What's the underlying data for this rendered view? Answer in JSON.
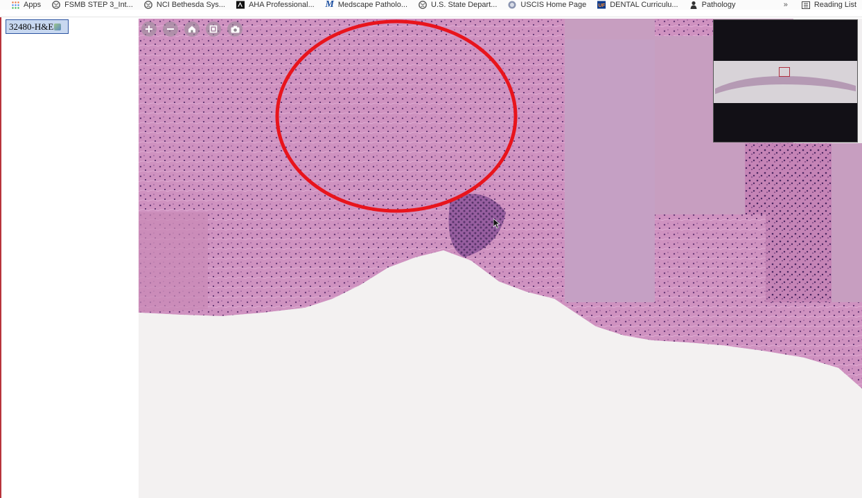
{
  "bookmarks": [
    {
      "label": "Apps",
      "icon": "apps-grid-icon"
    },
    {
      "label": "FSMB STEP 3_Int...",
      "icon": "globe-icon"
    },
    {
      "label": "NCI Bethesda Sys...",
      "icon": "globe-icon"
    },
    {
      "label": "AHA Professional...",
      "icon": "aha-logo-icon"
    },
    {
      "label": "Medscape Patholo...",
      "icon": "medscape-logo-icon"
    },
    {
      "label": "U.S. State Depart...",
      "icon": "globe-icon"
    },
    {
      "label": "USCIS Home Page",
      "icon": "uscis-seal-icon"
    },
    {
      "label": "DENTAL Curriculu...",
      "icon": "uf-logo-icon"
    },
    {
      "label": "Pathology",
      "icon": "person-icon"
    }
  ],
  "overflow_label": "»",
  "reading_list": {
    "label": "Reading List",
    "icon": "reading-list-icon"
  },
  "slide": {
    "label": "32480-H&E"
  },
  "viewer": {
    "toolbar": [
      {
        "name": "zoom-in-button",
        "icon": "plus-icon"
      },
      {
        "name": "zoom-out-button",
        "icon": "minus-icon"
      },
      {
        "name": "home-button",
        "icon": "home-icon"
      },
      {
        "name": "fullscreen-button",
        "icon": "fullscreen-icon"
      },
      {
        "name": "screenshot-button",
        "icon": "camera-icon"
      }
    ],
    "annotation_color": "#e8141c",
    "tissue_color": "#c98bb8"
  }
}
